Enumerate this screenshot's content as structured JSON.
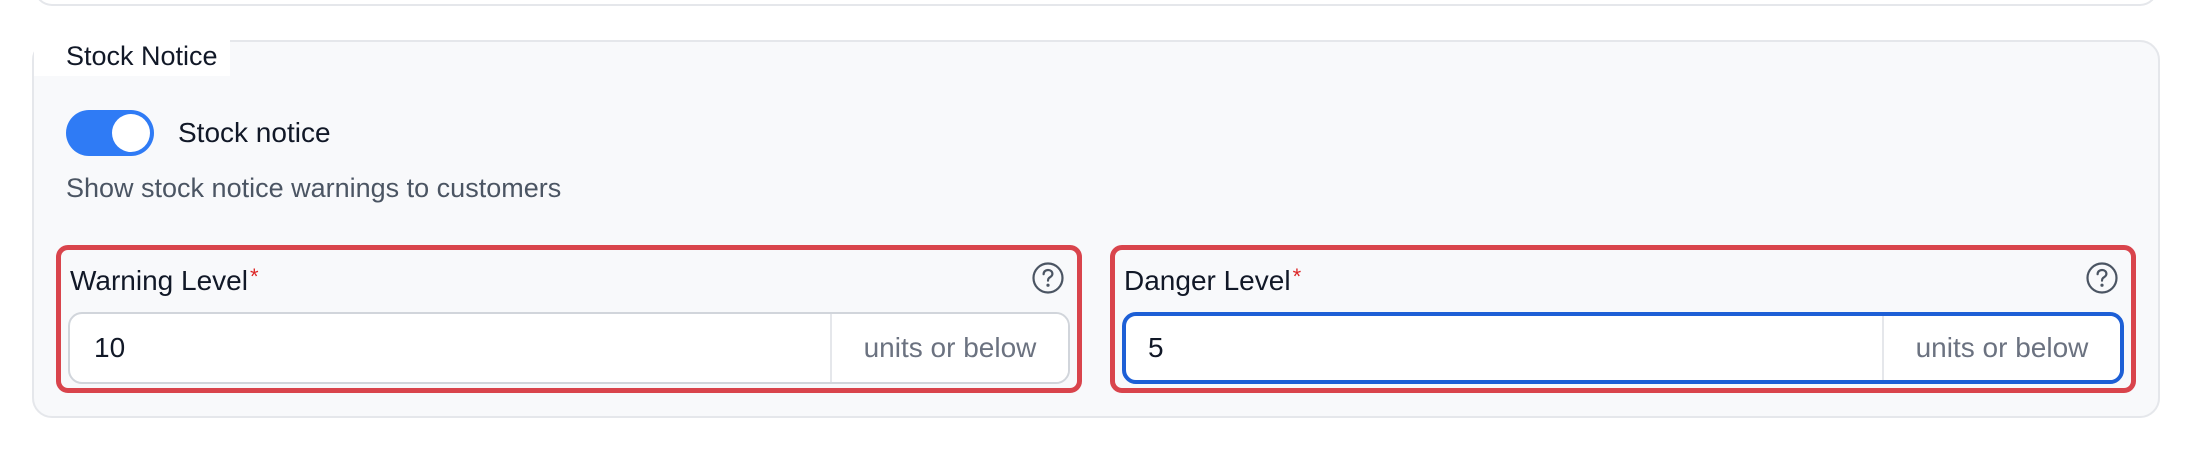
{
  "section": {
    "legend": "Stock Notice"
  },
  "toggle": {
    "label": "Stock notice",
    "enabled": true,
    "description": "Show stock notice warnings to customers",
    "on_color": "#2f7bf5"
  },
  "fields": {
    "warning": {
      "label": "Warning Level",
      "required_mark": "*",
      "value": "10",
      "suffix": "units or below",
      "help_icon": "question-circle-icon"
    },
    "danger": {
      "label": "Danger Level",
      "required_mark": "*",
      "value": "5",
      "suffix": "units or below",
      "help_icon": "question-circle-icon",
      "focused": true
    }
  },
  "colors": {
    "highlight_border": "#d9444c",
    "focus_border": "#1d5fd6",
    "required": "#dc2626"
  }
}
